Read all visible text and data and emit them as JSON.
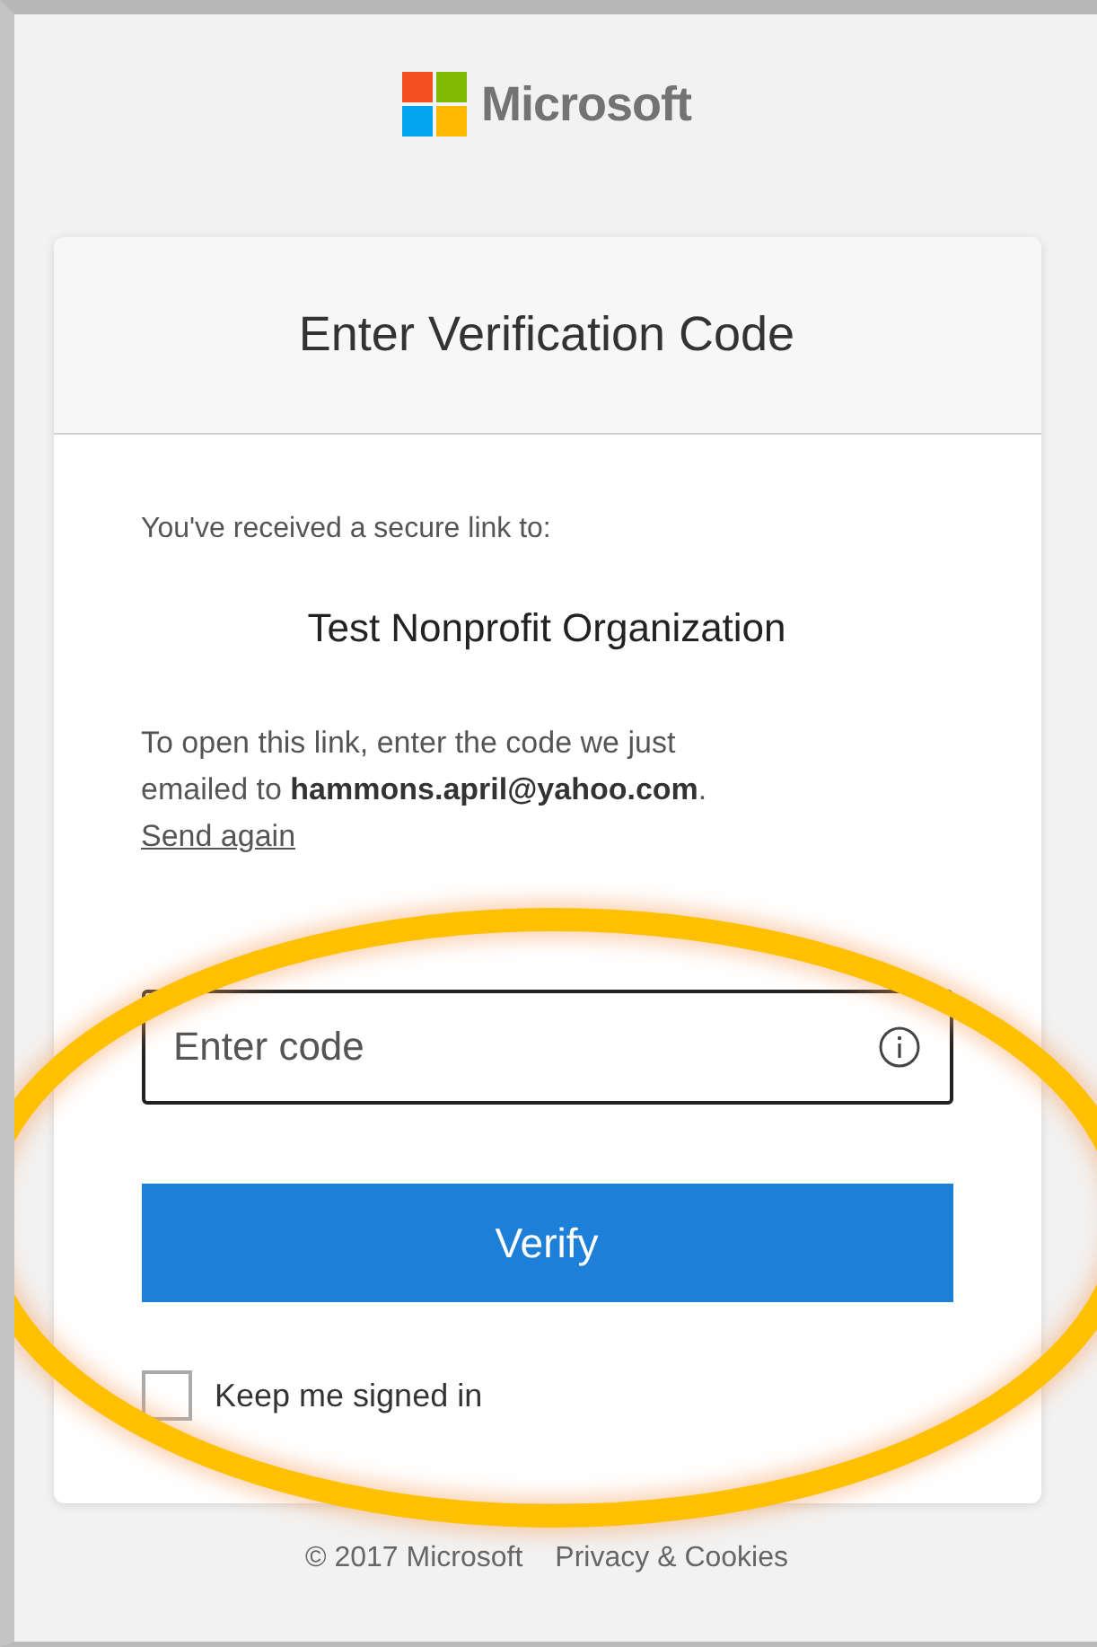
{
  "brand": {
    "name": "Microsoft"
  },
  "card": {
    "title": "Enter Verification Code",
    "intro": "You've received a secure link to:",
    "recipient": "Test Nonprofit Organization",
    "instructions": "To open this link, enter the code we just emailed to **hammons.april@yahoo.com**.",
    "resend_link": "Send again",
    "code_field": {
      "placeholder": "Enter code",
      "focused": true
    },
    "verify_button": "Verify",
    "keep_signed_in": {
      "label": "Keep me signed in",
      "checked": false
    }
  },
  "footer": {
    "copyright": "© 2017 Microsoft",
    "privacy_link": "Privacy & Cookies"
  },
  "annotation": {
    "kind": "ellipse",
    "color": "#ffc000"
  }
}
